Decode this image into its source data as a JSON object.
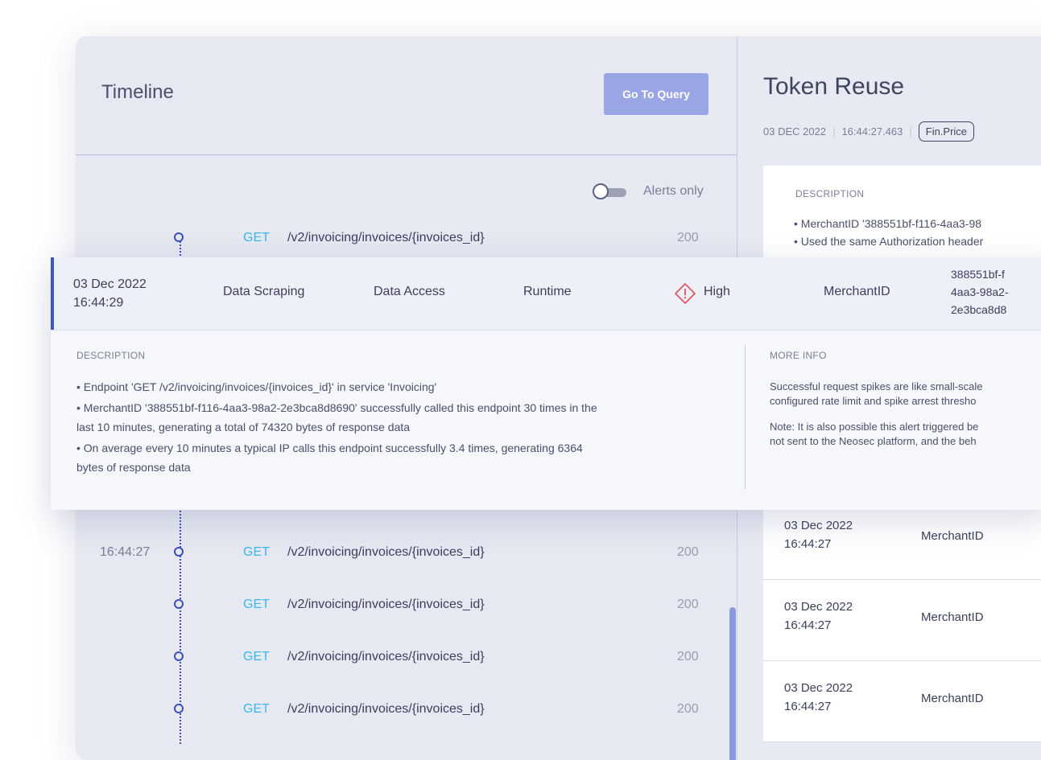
{
  "timeline": {
    "title": "Timeline",
    "go_to_query": "Go To Query",
    "alerts_only_label": "Alerts only",
    "rows": [
      {
        "time": "",
        "method": "GET",
        "path": "/v2/invoicing/invoices/{invoices_id}",
        "status": "200"
      },
      {
        "time": "16:44:27",
        "method": "GET",
        "path": "/v2/invoicing/invoices/{invoices_id}",
        "status": "200"
      },
      {
        "time": "",
        "method": "GET",
        "path": "/v2/invoicing/invoices/{invoices_id}",
        "status": "200"
      },
      {
        "time": "",
        "method": "GET",
        "path": "/v2/invoicing/invoices/{invoices_id}",
        "status": "200"
      },
      {
        "time": "",
        "method": "GET",
        "path": "/v2/invoicing/invoices/{invoices_id}",
        "status": "200"
      }
    ]
  },
  "detail": {
    "title": "Token Reuse",
    "date": "03 DEC 2022",
    "time": "16:44:27.463",
    "tag": "Fin.Price",
    "description_title": "DESCRIPTION",
    "description_lines": [
      "• MerchantID '388551bf-f116-4aa3-98",
      "• Used the same Authorization header"
    ],
    "list": [
      {
        "date": "03 Dec 2022",
        "time": "16:44:27",
        "key": "MerchantID"
      },
      {
        "date": "03 Dec 2022",
        "time": "16:44:27",
        "key": "MerchantID"
      },
      {
        "date": "03 Dec 2022",
        "time": "16:44:27",
        "key": "MerchantID"
      }
    ]
  },
  "alert": {
    "date": "03 Dec 2022",
    "time": "16:44:29",
    "name": "Data Scraping",
    "category": "Data Access",
    "phase": "Runtime",
    "severity": "High",
    "entity_type": "MerchantID",
    "entity_lines": [
      "388551bf-f",
      "4aa3-98a2-",
      "2e3bca8d8"
    ],
    "description_title": "DESCRIPTION",
    "description_lines": [
      "• Endpoint 'GET /v2/invoicing/invoices/{invoices_id}' in service 'Invoicing'",
      "• MerchantID '388551bf-f116-4aa3-98a2-2e3bca8d8690' successfully called this endpoint 30 times in the",
      "last 10 minutes, generating a total of 74320 bytes of response data",
      "• On average every 10 minutes a typical IP calls this endpoint successfully 3.4 times, generating 6364",
      "bytes of response data"
    ],
    "more_info_title": "MORE INFO",
    "more_info_lines": [
      "Successful request spikes are like small-scale",
      "configured rate limit and spike arrest thresho",
      "Note: It is also possible this alert triggered be",
      "not sent to the Neosec platform, and the beh"
    ]
  },
  "colors": {
    "accent": "#3f55c6",
    "method_get": "#3bb8e8",
    "button_bg": "#9aa5e4",
    "severity_high": "#e0505f"
  }
}
